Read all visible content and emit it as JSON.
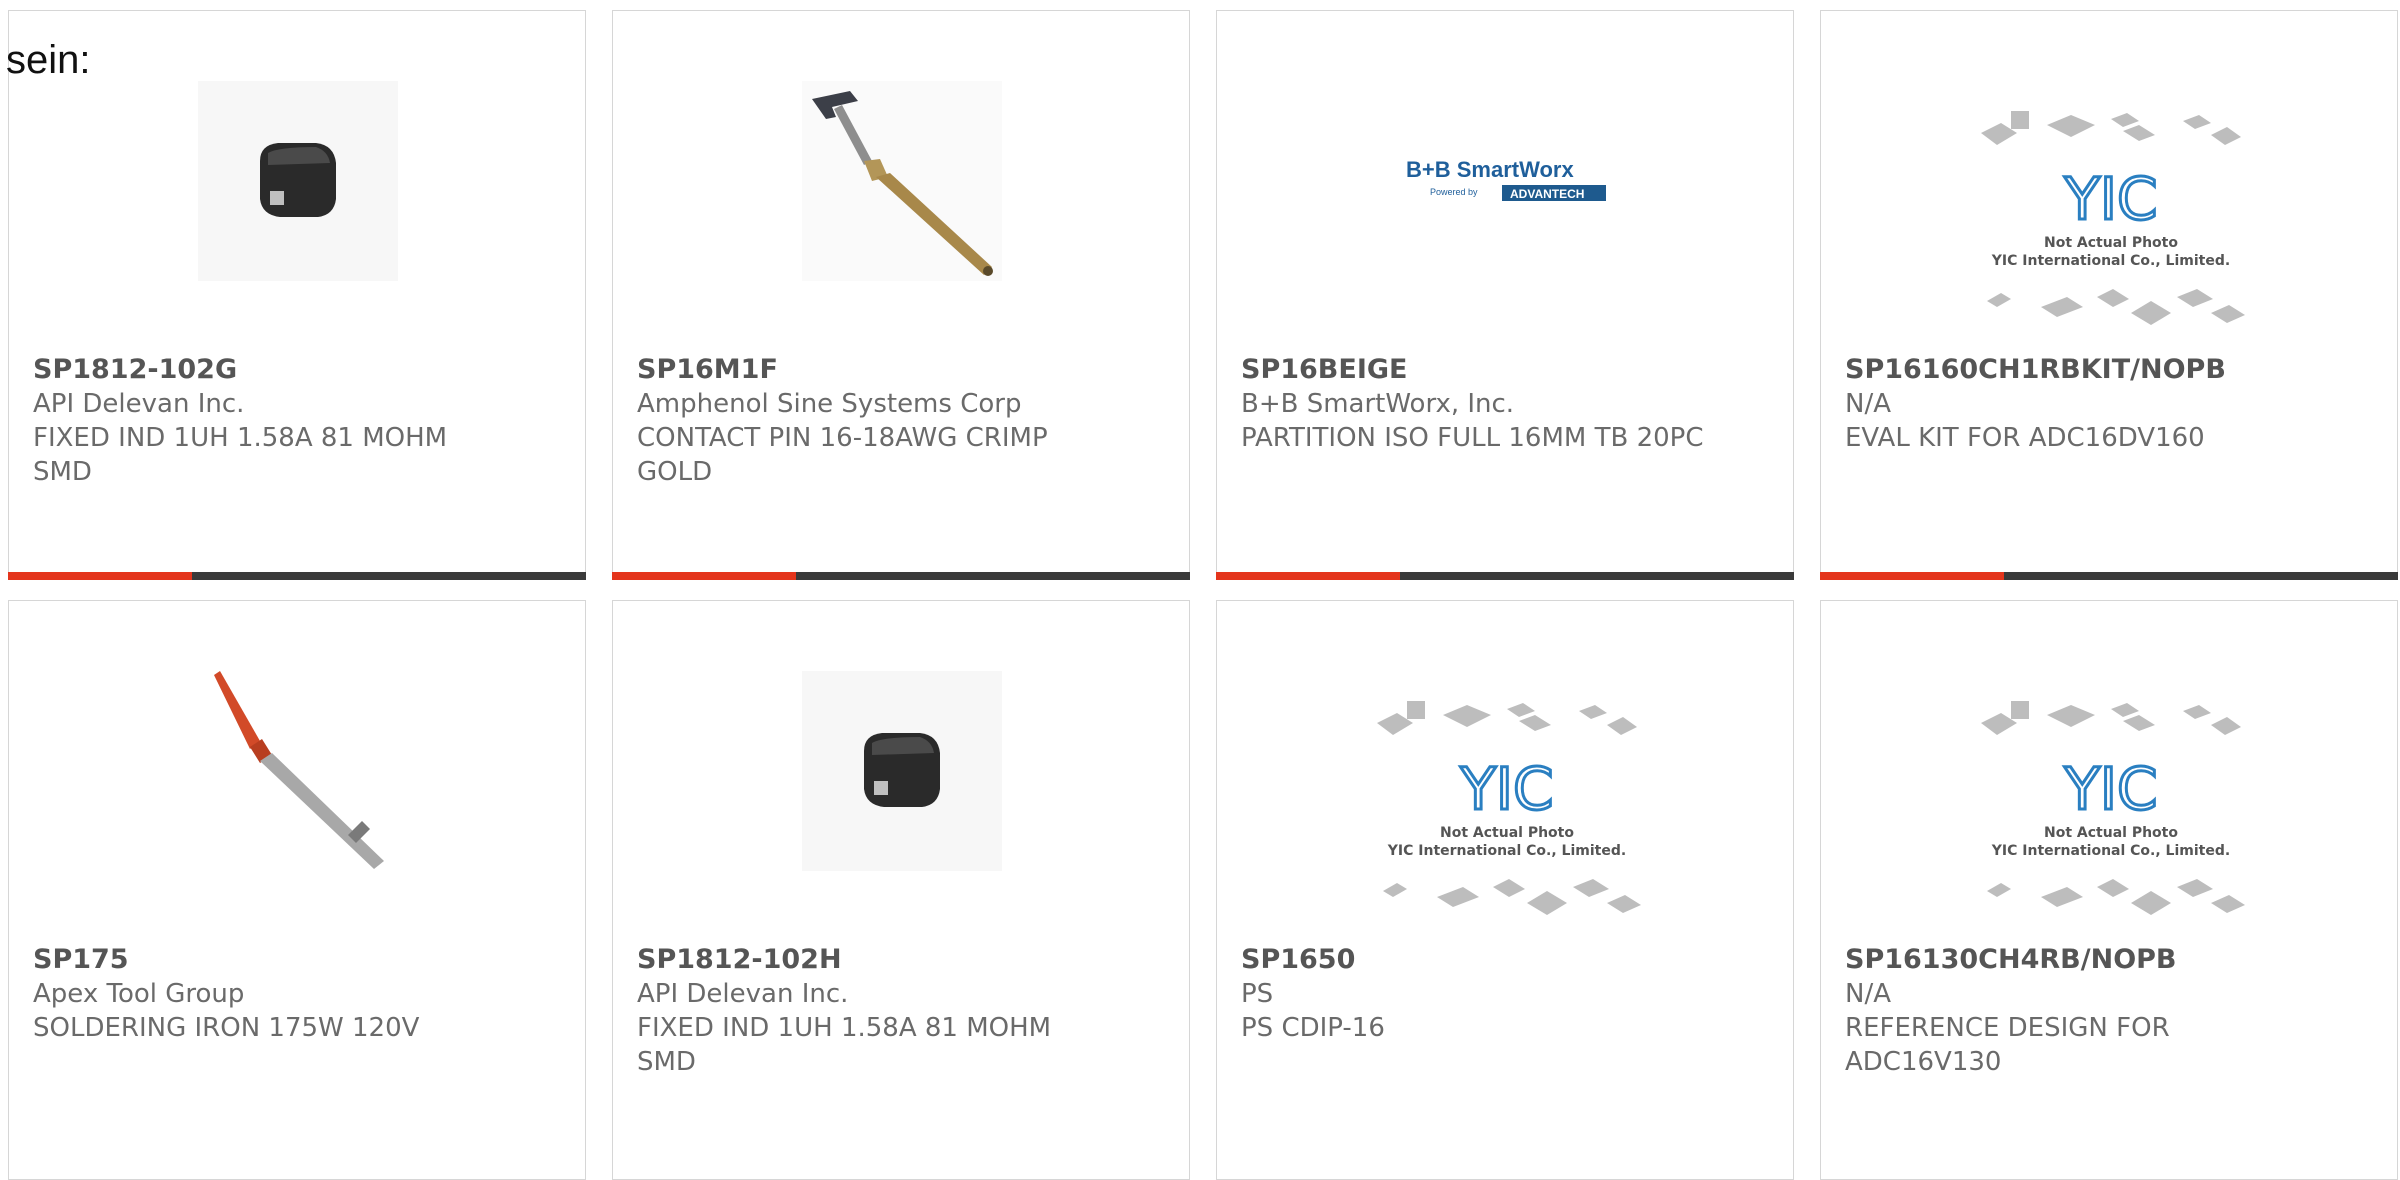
{
  "lead_text": "sein:",
  "cards": [
    {
      "part": "SP1812-102G",
      "manufacturer": "API Delevan Inc.",
      "description": "FIXED IND 1UH 1.58A 81 MOHM SMD",
      "image": "inductor-photo"
    },
    {
      "part": "SP16M1F",
      "manufacturer": "Amphenol Sine Systems Corp",
      "description": "CONTACT PIN 16-18AWG CRIMP GOLD",
      "image": "contact-pin-photo"
    },
    {
      "part": "SP16BEIGE",
      "manufacturer": "B+B SmartWorx, Inc.",
      "description": "PARTITION ISO FULL 16MM TB 20PC",
      "image": "bb-smartworx-logo",
      "logo": {
        "line1": "B+B SmartWorx",
        "line2": "Powered by",
        "line3": "ADVANTECH"
      }
    },
    {
      "part": "SP16160CH1RBKIT/NOPB",
      "manufacturer": "N/A",
      "description": "EVAL KIT FOR ADC16DV160",
      "image": "placeholder-photo",
      "placeholder": {
        "brand": "YIC",
        "line1": "Not Actual Photo",
        "line2": "YIC International Co., Limited."
      }
    },
    {
      "part": "SP175",
      "manufacturer": "Apex Tool Group",
      "description": "SOLDERING IRON 175W 120V",
      "image": "soldering-iron-photo"
    },
    {
      "part": "SP1812-102H",
      "manufacturer": "API Delevan Inc.",
      "description": "FIXED IND 1UH 1.58A 81 MOHM SMD",
      "image": "inductor-photo"
    },
    {
      "part": "SP1650",
      "manufacturer": "PS",
      "description": "PS CDIP-16",
      "image": "placeholder-photo",
      "placeholder": {
        "brand": "YIC",
        "line1": "Not Actual Photo",
        "line2": "YIC International Co., Limited."
      }
    },
    {
      "part": "SP16130CH4RB/NOPB",
      "manufacturer": "N/A",
      "description": "REFERENCE DESIGN FOR ADC16V130",
      "image": "placeholder-photo",
      "placeholder": {
        "brand": "YIC",
        "line1": "Not Actual Photo",
        "line2": "YIC International Co., Limited."
      }
    }
  ],
  "colors": {
    "accent": "#e4351c",
    "bar": "#3a3a3a",
    "border": "#d6d6d6",
    "text": "#6a6a6a"
  }
}
